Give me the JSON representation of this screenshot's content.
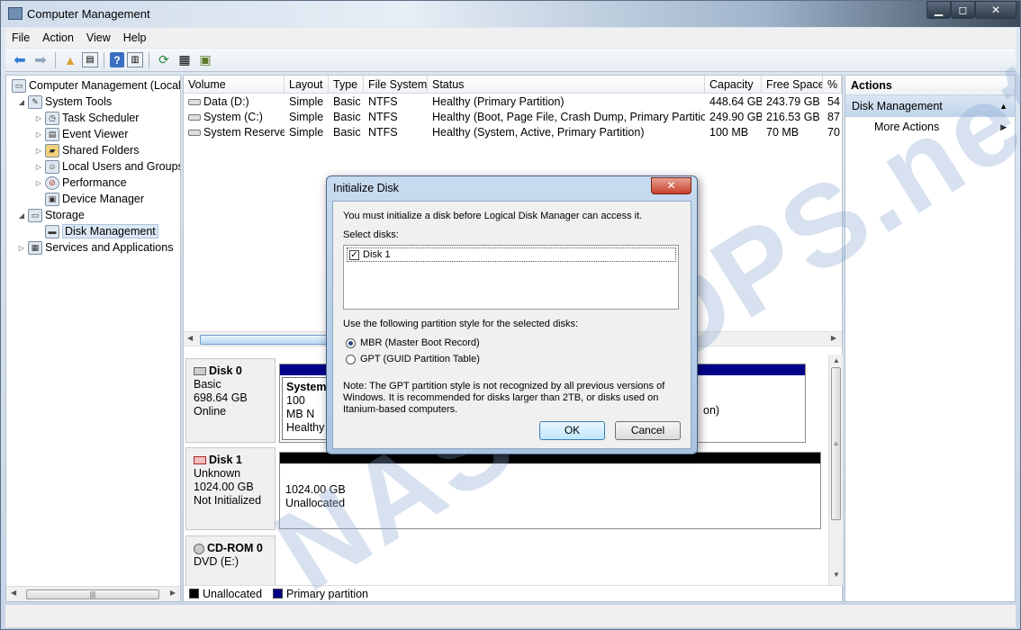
{
  "window": {
    "title": "Computer Management",
    "controls": [
      "▁",
      "◻",
      "✕"
    ]
  },
  "menubar": [
    "File",
    "Action",
    "View",
    "Help"
  ],
  "tree": {
    "root": "Computer Management (Local",
    "items": [
      {
        "label": "System Tools"
      },
      {
        "label": "Task Scheduler"
      },
      {
        "label": "Event Viewer"
      },
      {
        "label": "Shared Folders"
      },
      {
        "label": "Local Users and Groups"
      },
      {
        "label": "Performance"
      },
      {
        "label": "Device Manager"
      },
      {
        "label": "Storage"
      },
      {
        "label": "Disk Management"
      },
      {
        "label": "Services and Applications"
      }
    ]
  },
  "volumes": {
    "columns": [
      "Volume",
      "Layout",
      "Type",
      "File System",
      "Status",
      "Capacity",
      "Free Space",
      "%"
    ],
    "rows": [
      [
        "Data (D:)",
        "Simple",
        "Basic",
        "NTFS",
        "Healthy (Primary Partition)",
        "448.64 GB",
        "243.79 GB",
        "54"
      ],
      [
        "System (C:)",
        "Simple",
        "Basic",
        "NTFS",
        "Healthy (Boot, Page File, Crash Dump, Primary Partition)",
        "249.90 GB",
        "216.53 GB",
        "87"
      ],
      [
        "System Reserved",
        "Simple",
        "Basic",
        "NTFS",
        "Healthy (System, Active, Primary Partition)",
        "100 MB",
        "70 MB",
        "70"
      ]
    ]
  },
  "disks": {
    "disk0": {
      "name": "Disk 0",
      "type": "Basic",
      "size": "698.64 GB",
      "status": "Online",
      "partition": {
        "name": "System",
        "size": "100 MB N",
        "status": "Healthy"
      },
      "right_fragment": "on)"
    },
    "disk1": {
      "name": "Disk 1",
      "type": "Unknown",
      "size": "1024.00 GB",
      "status": "Not Initialized",
      "partition": {
        "size": "1024.00 GB",
        "status": "Unallocated"
      }
    },
    "cdrom0": {
      "name": "CD-ROM 0",
      "drive": "DVD (E:)"
    }
  },
  "legend": {
    "unallocated": "Unallocated",
    "primary": "Primary partition",
    "unallocated_color": "#000000",
    "primary_color": "#00008b"
  },
  "actions": {
    "header": "Actions",
    "section": "Disk Management",
    "item": "More Actions"
  },
  "watermark": "NASSHOPS.net",
  "dialog": {
    "title": "Initialize Disk",
    "intro": "You must initialize a disk before Logical Disk Manager can access it.",
    "select_label": "Select disks:",
    "disk_item": "Disk 1",
    "style_label": "Use the following partition style for the selected disks:",
    "mbr": "MBR (Master Boot Record)",
    "gpt": "GPT (GUID Partition Table)",
    "note": "Note: The GPT partition style is not recognized by all previous versions of Windows. It is recommended for disks larger than 2TB, or disks used on Itanium-based computers.",
    "ok": "OK",
    "cancel": "Cancel",
    "close": "✕"
  }
}
